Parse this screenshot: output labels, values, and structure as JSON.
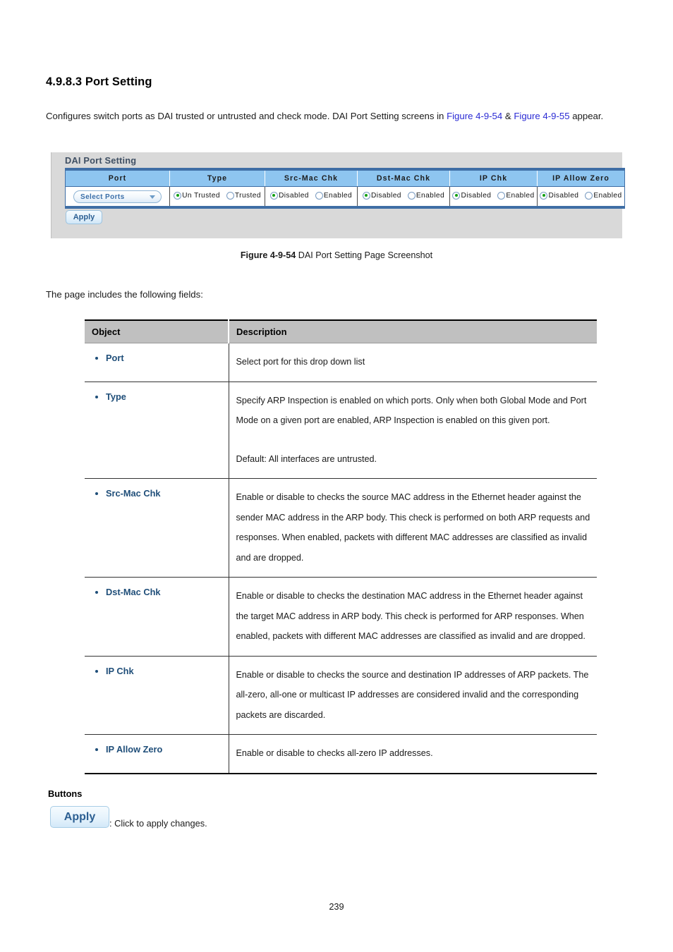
{
  "document": {
    "heading": "4.9.8.3 Port Setting",
    "intro_pre": "Configures switch ports as DAI trusted or untrusted and check mode. DAI Port Setting screens in ",
    "intro_link1": "Figure 4-9-54",
    "intro_amp": " & ",
    "intro_link2": "Figure 4-9-55",
    "intro_post": " appear.",
    "fields_lead": "The page includes the following fields:",
    "figure_caption_bold": "Figure 4-9-54",
    "figure_caption_rest": " DAI Port Setting Page Screenshot",
    "page_number": "239",
    "link_color": "#2b2bd4"
  },
  "figure": {
    "panel_title": "DAI Port Setting",
    "columns": [
      "Port",
      "Type",
      "Src-Mac Chk",
      "Dst-Mac Chk",
      "IP Chk",
      "IP Allow Zero"
    ],
    "port_select_value": "Select Ports",
    "type_options": [
      {
        "label": "Un Trusted",
        "selected": true
      },
      {
        "label": "Trusted",
        "selected": false
      }
    ],
    "src_mac_options": [
      {
        "label": "Disabled",
        "selected": true
      },
      {
        "label": "Enabled",
        "selected": false
      }
    ],
    "dst_mac_options": [
      {
        "label": "Disabled",
        "selected": true
      },
      {
        "label": "Enabled",
        "selected": false
      }
    ],
    "ip_chk_options": [
      {
        "label": "Disabled",
        "selected": true
      },
      {
        "label": "Enabled",
        "selected": false
      }
    ],
    "ip_allow_zero_options": [
      {
        "label": "Disabled",
        "selected": true
      },
      {
        "label": "Enabled",
        "selected": false
      }
    ],
    "apply_label": "Apply",
    "header_bg": "#8ec5f0",
    "border_color": "#3f6ea5"
  },
  "table": {
    "headers": [
      "Object",
      "Description"
    ],
    "rows": [
      {
        "object": "Port",
        "paragraphs": [
          "Select port for this drop down list"
        ]
      },
      {
        "object": "Type",
        "paragraphs": [
          "Specify ARP Inspection is enabled on which ports. Only when both Global Mode and Port Mode on a given port are enabled, ARP Inspection is enabled on this given port.",
          "Default: All interfaces are untrusted."
        ]
      },
      {
        "object": "Src-Mac Chk",
        "paragraphs": [
          "Enable or disable to checks the source MAC address in the Ethernet header against the sender MAC address in the ARP body. This check is performed on both ARP requests and responses. When enabled, packets with different MAC addresses are classified as invalid and are dropped."
        ]
      },
      {
        "object": "Dst-Mac Chk",
        "paragraphs": [
          "Enable or disable to checks the destination MAC address in the Ethernet header against the target MAC address in ARP body. This check is performed for ARP responses. When enabled, packets with different MAC addresses are classified as invalid and are dropped."
        ]
      },
      {
        "object": "IP Chk",
        "paragraphs": [
          "Enable or disable to checks the source and destination IP addresses of ARP packets. The all-zero, all-one or multicast IP addresses are considered invalid and the corresponding packets are discarded."
        ]
      },
      {
        "object": "IP Allow Zero",
        "paragraphs": [
          "Enable or disable to checks all-zero IP addresses."
        ]
      }
    ]
  },
  "buttons_section": {
    "title": "Buttons",
    "apply_label": "Apply",
    "apply_description": ": Click to apply changes."
  }
}
